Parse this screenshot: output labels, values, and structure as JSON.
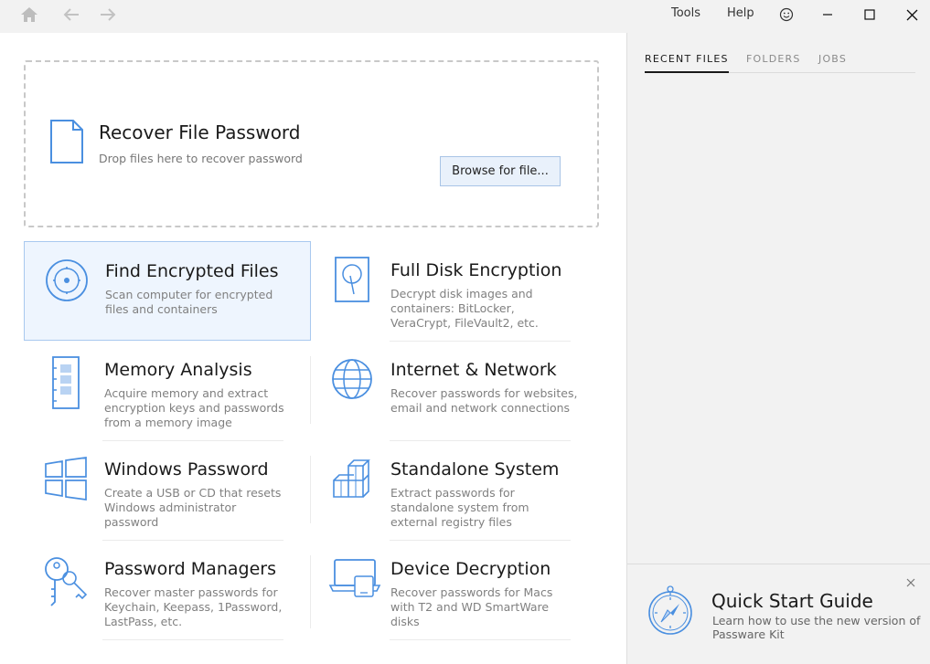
{
  "titlebar": {
    "menu": {
      "tools": "Tools",
      "help": "Help"
    },
    "icons": [
      "home-icon",
      "back-arrow-icon",
      "forward-arrow-icon",
      "smiley-feedback-icon",
      "minimize-icon",
      "maximize-icon",
      "close-icon"
    ]
  },
  "dropzone": {
    "title": "Recover File Password",
    "subtitle": "Drop files here to recover password",
    "browse_label": "Browse for file..."
  },
  "cards": [
    {
      "title": "Find Encrypted Files",
      "desc": "Scan computer for encrypted files and containers",
      "icon": "disk-scan-icon",
      "selected": true
    },
    {
      "title": "Full Disk Encryption",
      "desc": "Decrypt disk images and containers: BitLocker, VeraCrypt, FileVault2, etc.",
      "icon": "hard-drive-icon",
      "selected": false
    },
    {
      "title": "Memory Analysis",
      "desc": "Acquire memory and extract encryption keys and passwords from a memory image",
      "icon": "memory-chip-icon",
      "selected": false
    },
    {
      "title": "Internet & Network",
      "desc": "Recover passwords for websites, email and network connections",
      "icon": "globe-icon",
      "selected": false
    },
    {
      "title": "Windows Password",
      "desc": "Create a USB or CD that resets Windows administrator password",
      "icon": "windows-logo-icon",
      "selected": false
    },
    {
      "title": "Standalone System",
      "desc": "Extract passwords for standalone system from external registry files",
      "icon": "cubes-icon",
      "selected": false
    },
    {
      "title": "Password Managers",
      "desc": "Recover master passwords for Keychain, Keepass, 1Password, LastPass, etc.",
      "icon": "keys-icon",
      "selected": false
    },
    {
      "title": "Device Decryption",
      "desc": "Recover passwords for Macs with T2 and WD SmartWare disks",
      "icon": "laptop-icon",
      "selected": false
    }
  ],
  "sidebar": {
    "tabs": [
      {
        "label": "RECENT FILES",
        "active": true
      },
      {
        "label": "FOLDERS",
        "active": false
      },
      {
        "label": "JOBS",
        "active": false
      }
    ],
    "quickstart": {
      "title": "Quick Start Guide",
      "subtitle": "Learn how to use the new version of Passware Kit"
    }
  },
  "colors": {
    "accent_blue": "#4a8fe0",
    "selected_bg": "#eef5fe",
    "selected_border": "#a9c9ef",
    "button_bg": "#e9f1fb"
  }
}
